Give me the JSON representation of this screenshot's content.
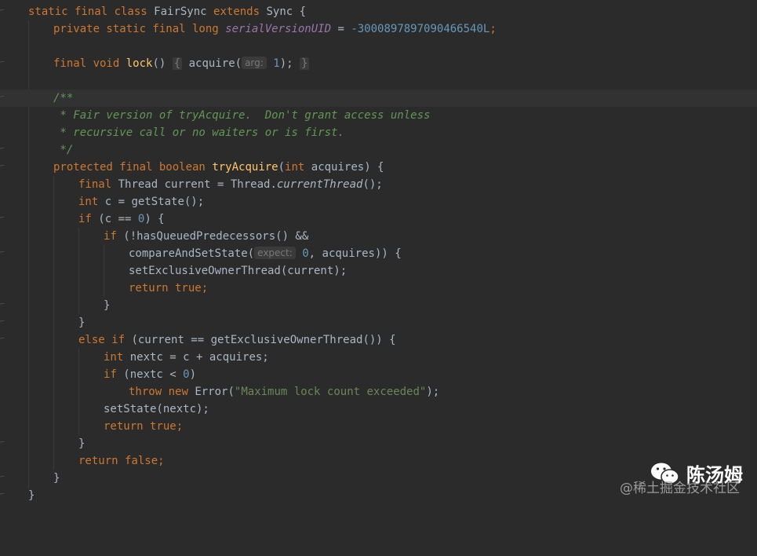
{
  "code": {
    "class_decl": {
      "kw": "static final class",
      "name": "FairSync",
      "extends_kw": "extends",
      "parent": "Sync",
      "brace": " {"
    },
    "serial": {
      "kw": "private static final long",
      "name": "serialVersionUID",
      "eq": " = ",
      "value": "-3000897897090466540L",
      "semi": ";"
    },
    "lock": {
      "kw": "final void",
      "name": "lock",
      "paren": "()",
      "ob": "{",
      "call": "acquire(",
      "hint": "arg:",
      "arg": "1",
      "end": ");",
      "cb": "}"
    },
    "comment": [
      "/**",
      " * Fair version of tryAcquire.  Don't grant access unless",
      " * recursive call or no waiters or is first.",
      " */"
    ],
    "try_decl": {
      "kw": "protected final boolean",
      "name": "tryAcquire",
      "open": "(",
      "int_kw": "int",
      "param": " acquires) {"
    },
    "current_line": {
      "kw": "final",
      "t1": " Thread current = Thread.",
      "m": "currentThread",
      "t2": "();"
    },
    "c_line": {
      "kw": "int",
      "t": " c = getState();"
    },
    "if_c": {
      "kw": "if",
      "t1": " (c == ",
      "n": "0",
      "t2": ") {"
    },
    "if_has": {
      "kw": "if",
      "t": " (!hasQueuedPredecessors() &&"
    },
    "cas": {
      "t1": "compareAndSetState(",
      "hint": "expect:",
      "n": "0",
      "t2": ", acquires)) {"
    },
    "set_owner": {
      "t": "setExclusiveOwnerThread(current);"
    },
    "ret_true1": {
      "kw": "return",
      "v": " true",
      "semi": ";"
    },
    "close1": "}",
    "close2": "}",
    "else_if": {
      "kw": "else if",
      "t": " (current == getExclusiveOwnerThread()) {"
    },
    "nextc": {
      "kw": "int",
      "t": " nextc = c + acquires;"
    },
    "if_nextc": {
      "kw": "if",
      "t1": " (nextc < ",
      "n": "0",
      "t2": ")"
    },
    "throw": {
      "kw": "throw",
      "kw2": "new",
      "t1": " Error(",
      "s": "\"Maximum lock count exceeded\"",
      "t2": ");"
    },
    "setstate": {
      "t": "setState(nextc);"
    },
    "ret_true2": {
      "kw": "return",
      "v": " true",
      "semi": ";"
    },
    "close3": "}",
    "ret_false": {
      "kw": "return",
      "v": " false",
      "semi": ";"
    },
    "close4": "}",
    "close5": "}"
  },
  "watermark": {
    "author": "陈汤姆",
    "site": "@稀土掘金技术社区",
    "icon": "wechat-icon"
  }
}
